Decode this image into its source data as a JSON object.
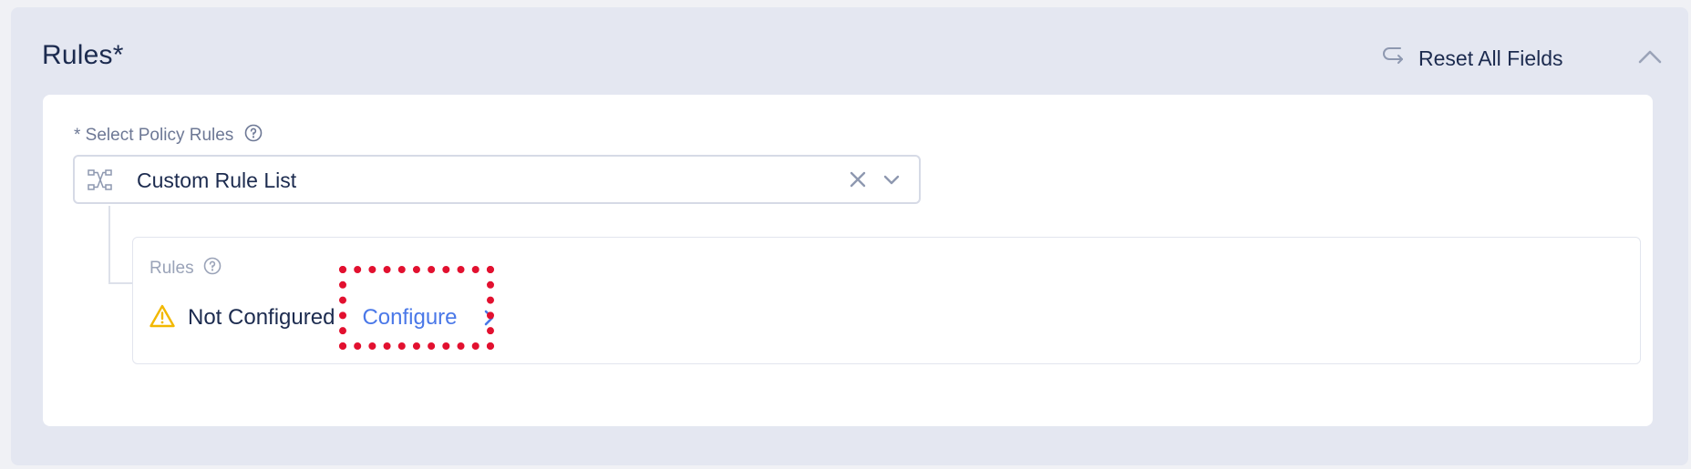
{
  "section": {
    "title": "Rules*",
    "reset_label": "Reset All Fields",
    "reset_icon": "return-arrow-icon",
    "collapse_icon": "chevron-up-icon"
  },
  "field": {
    "label": "* Select Policy Rules",
    "help_icon": "help-circle-icon",
    "select_icon": "rule-flow-icon",
    "selected_value": "Custom Rule List",
    "clear_icon": "close-icon",
    "dropdown_icon": "chevron-down-icon"
  },
  "rules_box": {
    "label": "Rules",
    "help_icon": "help-circle-icon",
    "status_icon": "warning-icon",
    "status_text": "Not Configured",
    "configure_label": "Configure",
    "configure_icon": "chevron-right-icon"
  },
  "colors": {
    "accent": "#4a78e8",
    "warning": "#f2b800",
    "highlight": "#e2102f",
    "text": "#1c2b4f"
  }
}
